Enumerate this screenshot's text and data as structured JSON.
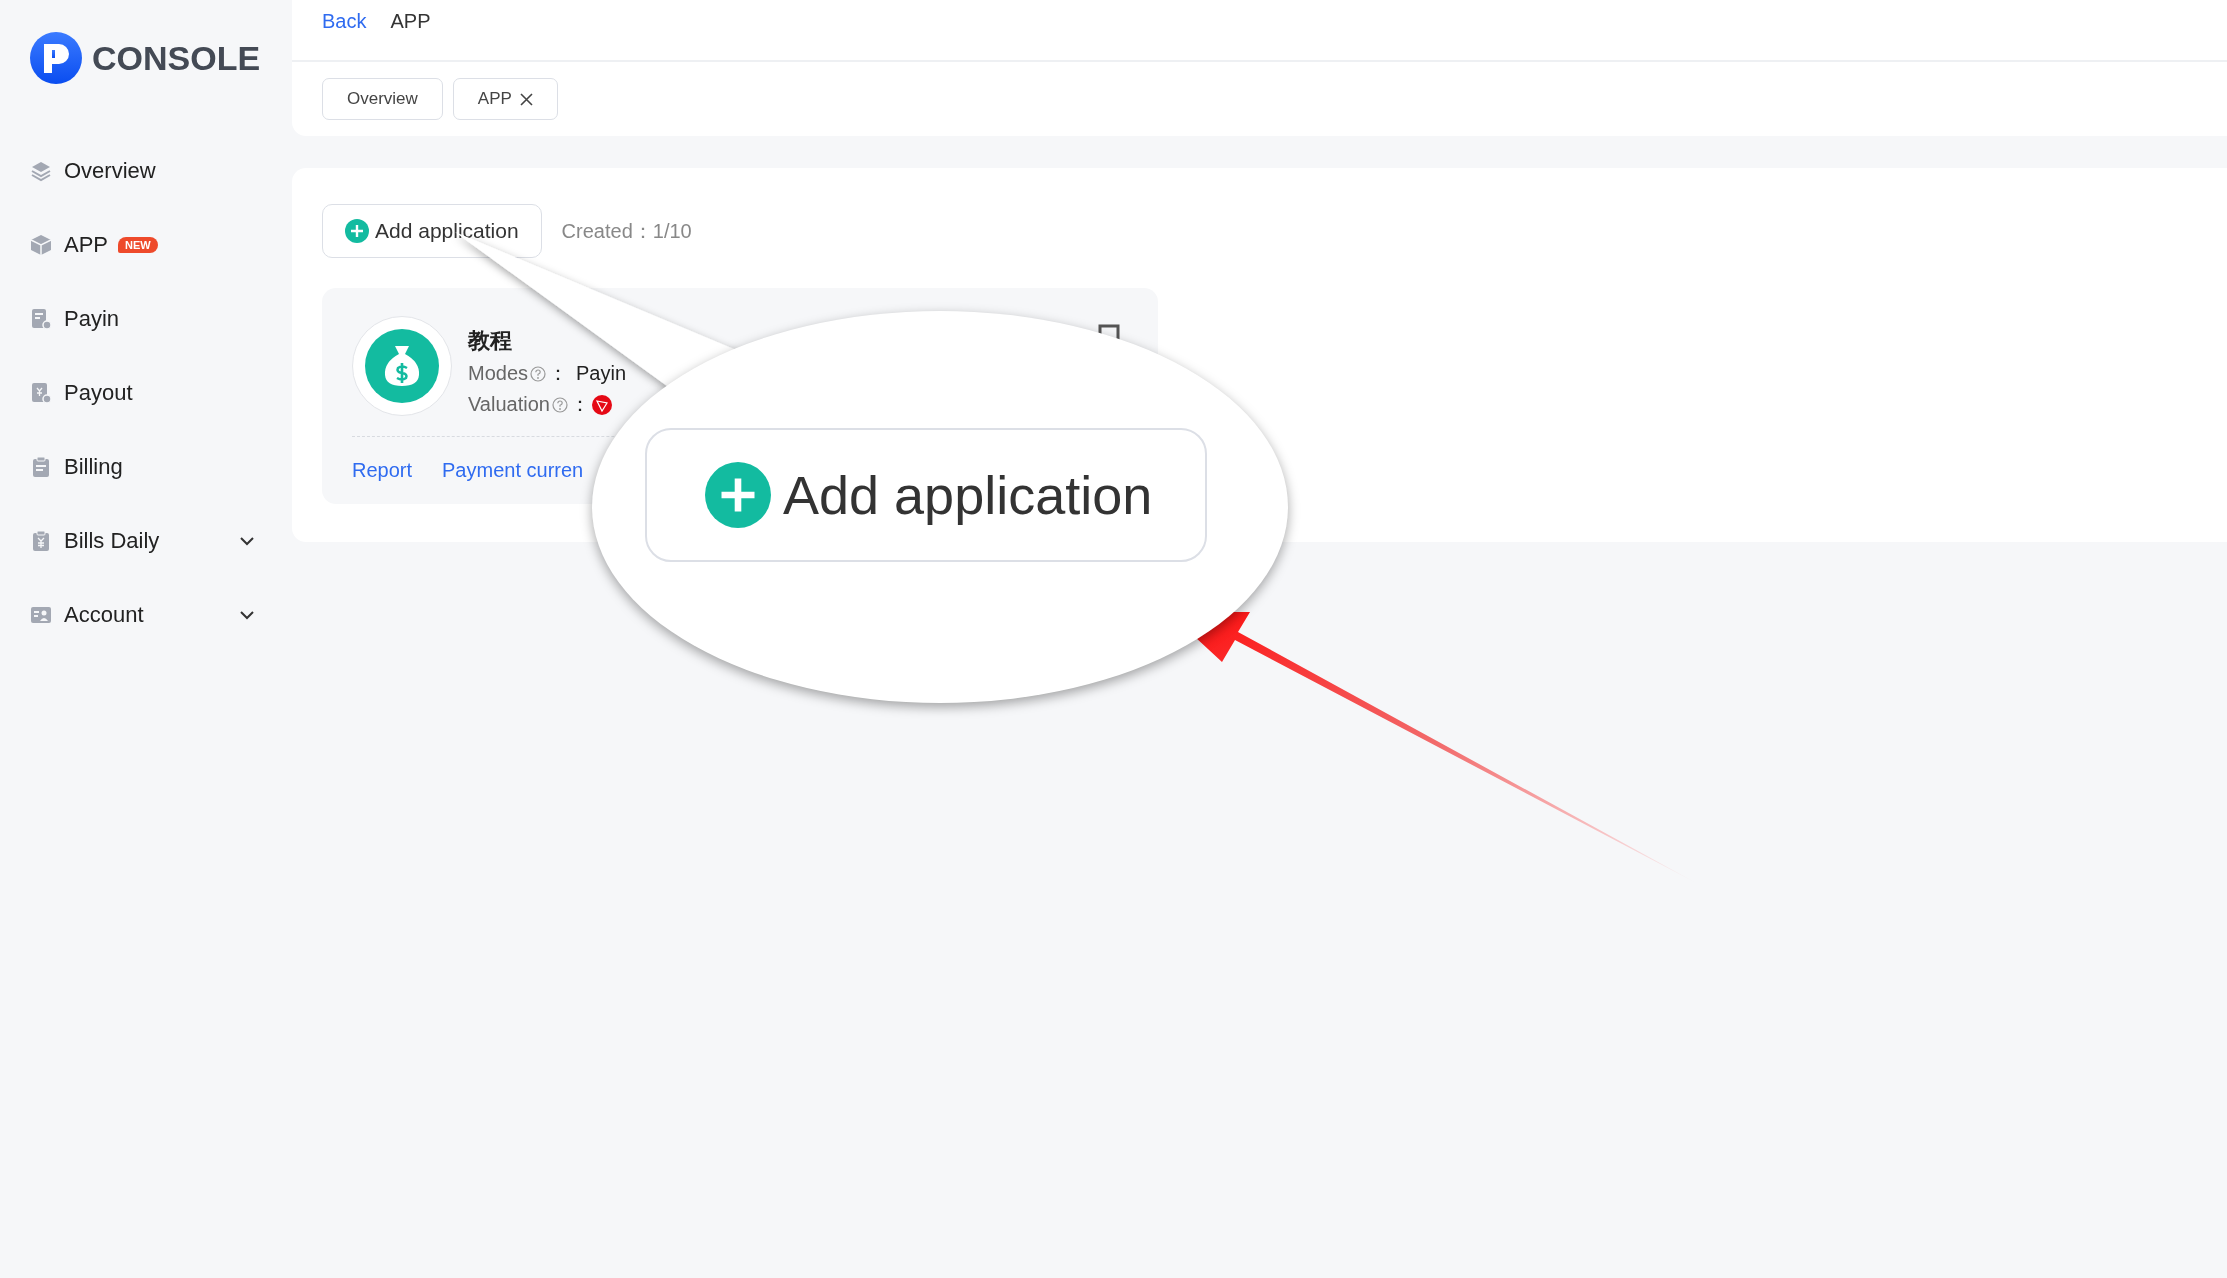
{
  "sidebar": {
    "logo": "CONSOLE",
    "items": [
      {
        "label": "Overview",
        "has_submenu": false
      },
      {
        "label": "APP",
        "badge": "NEW",
        "has_submenu": false
      },
      {
        "label": "Payin",
        "has_submenu": false
      },
      {
        "label": "Payout",
        "has_submenu": false
      },
      {
        "label": "Billing",
        "has_submenu": false
      },
      {
        "label": "Bills Daily",
        "has_submenu": true
      },
      {
        "label": "Account",
        "has_submenu": true
      }
    ]
  },
  "header": {
    "back": "Back",
    "current": "APP",
    "tabs": [
      {
        "label": "Overview",
        "closable": false
      },
      {
        "label": "APP",
        "closable": true
      }
    ]
  },
  "toolbar": {
    "add_button": "Add application",
    "created": "Created：1/10"
  },
  "app_card": {
    "title": "教程",
    "modes_label": "Modes",
    "modes_value": "Payin",
    "separator": "：",
    "valuation_label": "Valuation",
    "links": [
      "Report",
      "Payment curren"
    ]
  },
  "callout": {
    "button": "Add application"
  }
}
